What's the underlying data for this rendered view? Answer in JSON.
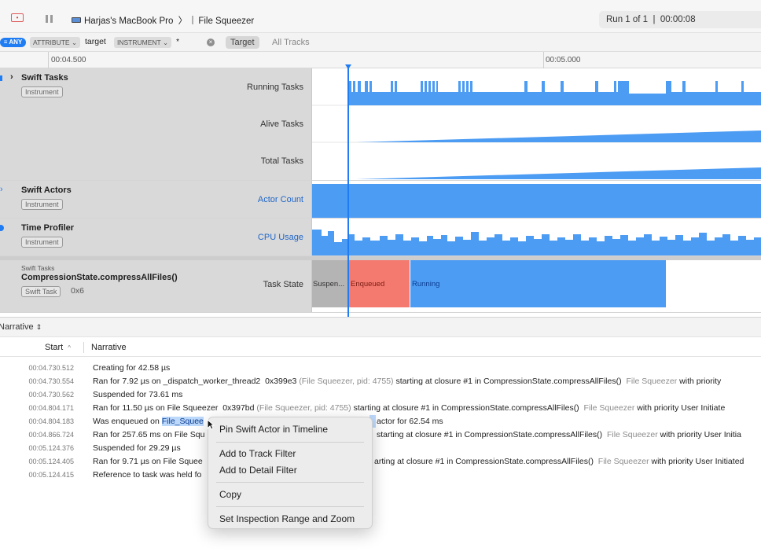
{
  "toolbar": {
    "device": "Harjas's MacBook Pro",
    "target": "File Squeezer",
    "run_status": "Run 1 of 1  |  00:00:08"
  },
  "filter": {
    "any_label": "ANY",
    "attribute_token": "ATTRIBUTE",
    "attribute_value": "target",
    "instrument_token": "INSTRUMENT",
    "instrument_value": "*",
    "scope_target": "Target",
    "scope_all": "All Tracks"
  },
  "ruler": {
    "ticks": [
      "00:04.500",
      "00:05.000"
    ]
  },
  "tracks": {
    "swift_tasks": {
      "name": "Swift Tasks",
      "badge": "Instrument",
      "series": [
        "Running Tasks",
        "Alive Tasks",
        "Total Tasks"
      ]
    },
    "swift_actors": {
      "name": "Swift Actors",
      "badge": "Instrument",
      "series": [
        "Actor Count"
      ]
    },
    "time_profiler": {
      "name": "Time Profiler",
      "badge": "Instrument",
      "series": [
        "CPU Usage"
      ]
    },
    "task": {
      "kind": "Swift Tasks",
      "name": "CompressionState.compressAllFiles()",
      "badge": "Swift Task",
      "id": "0x6",
      "series": "Task State",
      "states": [
        "Suspen...",
        "Enqueued",
        "Running"
      ]
    }
  },
  "detail": {
    "selector": "Narrative",
    "col_start": "Start",
    "col_narrative": "Narrative",
    "rows": [
      {
        "ts": "00:04.730.512",
        "a": "Creating for 42.58 µs",
        "b": "",
        "c": "",
        "d": "",
        "e": ""
      },
      {
        "ts": "00:04.730.554",
        "a": "Ran for 7.92 µs on _dispatch_worker_thread2  0x399e3 ",
        "b": "(File Squeezer, pid: 4755)",
        "c": " starting at closure #1 in CompressionState.compressAllFiles()  ",
        "d": "File Squeezer",
        "e": " with priority"
      },
      {
        "ts": "00:04.730.562",
        "a": "Suspended for 73.61 ms",
        "b": "",
        "c": "",
        "d": "",
        "e": ""
      },
      {
        "ts": "00:04.804.171",
        "a": "Ran for 11.50 µs on File Squeezer  0x397bd ",
        "b": "(File Squeezer, pid: 4755)",
        "c": " starting at closure #1 in CompressionState.compressAllFiles()  ",
        "d": "File Squeezer",
        "e": " with priority User Initiate"
      },
      {
        "ts": "00:04.804.183",
        "a": "Was enqueued on ",
        "hl": "File_Squee",
        "rest": "actor for 62.54 ms"
      },
      {
        "ts": "00:04.866.724",
        "a": "Ran for 257.65 ms on File Squ",
        "c": "starting at closure #1 in CompressionState.compressAllFiles()  ",
        "d": "File Squeezer",
        "e": " with priority User Initia"
      },
      {
        "ts": "00:05.124.376",
        "a": "Suspended for 29.29 µs",
        "b": "",
        "c": "",
        "d": "",
        "e": ""
      },
      {
        "ts": "00:05.124.405",
        "a": "Ran for 9.71 µs on File Squee",
        "c": "arting at closure #1 in CompressionState.compressAllFiles()  ",
        "d": "File Squeezer",
        "e": " with priority User Initiated"
      },
      {
        "ts": "00:05.124.415",
        "a": "Reference to task was held fo",
        "b": "",
        "c": "",
        "d": "",
        "e": ""
      }
    ]
  },
  "context_menu": {
    "items": [
      "Pin Swift Actor in Timeline",
      "Add to Track Filter",
      "Add to Detail Filter",
      "Copy",
      "Set Inspection Range and Zoom"
    ]
  },
  "colors": {
    "accent": "#1f7cf2",
    "graph": "#4c9cf4",
    "enqueued": "#f47a6f",
    "suspended": "#b4b4b4"
  }
}
